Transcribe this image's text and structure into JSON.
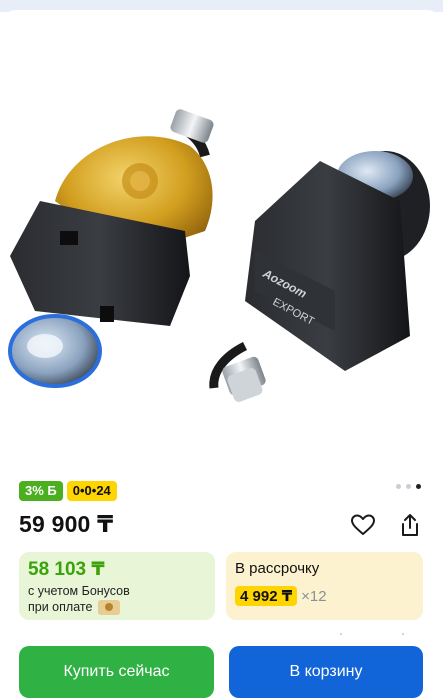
{
  "gallery": {
    "image_alt": "Aozoom EXPORT bi-LED projector lenses",
    "pager_count": 3,
    "pager_active_index": 2
  },
  "badges": {
    "bonus_percent": "3% Б",
    "installment_plan": "0•0•24"
  },
  "price": {
    "current": "59 900 ₸"
  },
  "bonus_card": {
    "price": "58 103 ₸",
    "line1": "с учетом Бонусов",
    "line2": "при оплате"
  },
  "installment_card": {
    "title": "В рассрочку",
    "monthly": "4 992 ₸",
    "multiplier": "×12"
  },
  "actions": {
    "buy_now": "Купить сейчас",
    "add_to_cart": "В корзину"
  },
  "colors": {
    "buy_now": "#2fb144",
    "cart": "#1264d9",
    "bonus_green": "#3aa30a",
    "badge_yellow": "#ffd500"
  },
  "icons": {
    "favorite": "heart-icon",
    "share": "share-icon",
    "coin": "kaspi-coin-icon"
  }
}
